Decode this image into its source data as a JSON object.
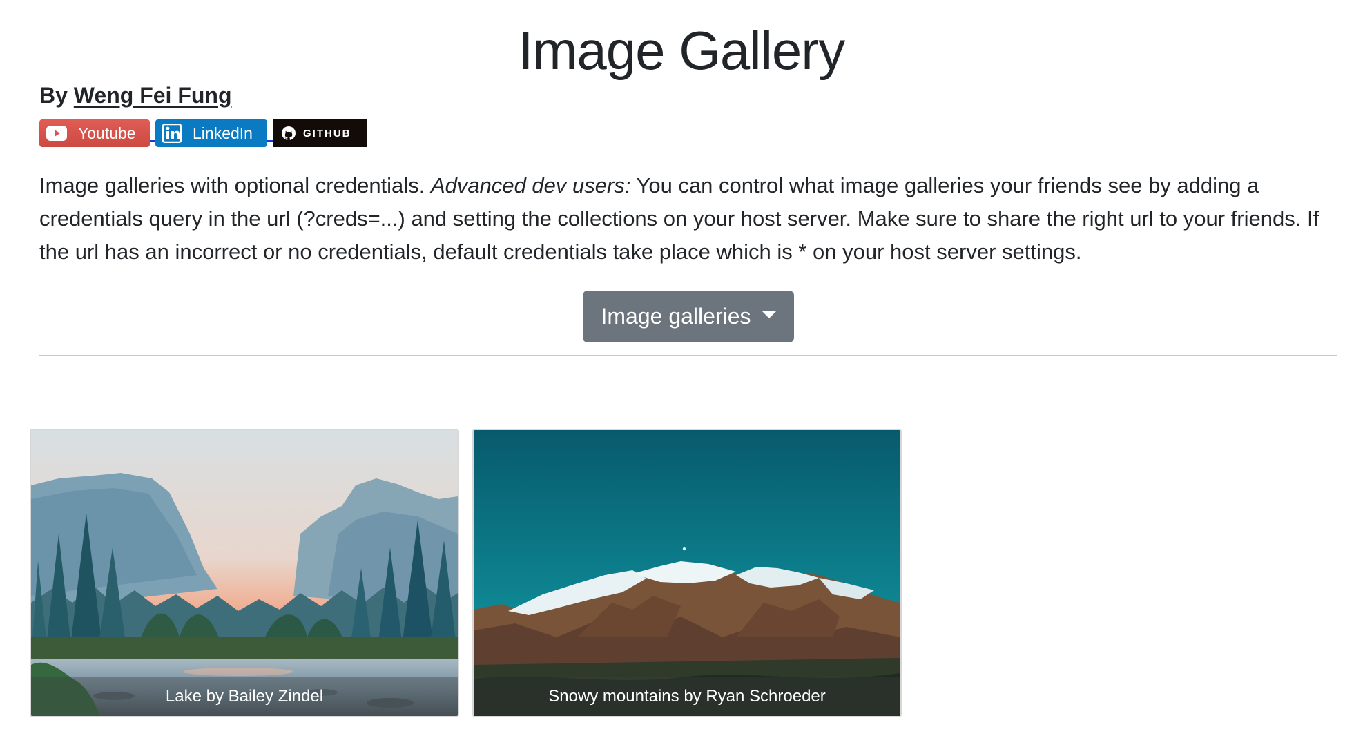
{
  "header": {
    "title": "Image Gallery",
    "byline_prefix": "By",
    "author_name": "Weng Fei Fung"
  },
  "badges": [
    {
      "label": "Youtube",
      "icon": "youtube-icon",
      "color": "#d9534f"
    },
    {
      "label": "LinkedIn",
      "icon": "linkedin-icon",
      "color": "#0a7bc2"
    },
    {
      "label": "GITHUB",
      "icon": "github-icon",
      "color": "#120b08"
    }
  ],
  "description": {
    "intro": "Image galleries with optional credentials.",
    "emphasis": "Advanced dev users:",
    "body": "You can control what image galleries your friends see by adding a credentials query in the url (?creds=...) and setting the collections on your host server. Make sure to share the right url to your friends. If the url has an incorrect or no credentials, default credentials take place which is * on your host server settings."
  },
  "dropdown": {
    "label": "Image galleries",
    "icon": "caret-down-icon",
    "color": "#6c757d"
  },
  "gallery": {
    "cards": [
      {
        "caption": "Lake by Bailey Zindel"
      },
      {
        "caption": "Snowy mountains by Ryan Schroeder"
      }
    ]
  }
}
